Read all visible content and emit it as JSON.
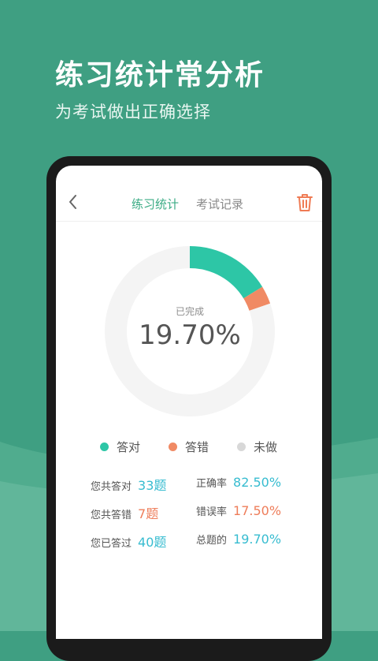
{
  "hero": {
    "title": "练习统计常分析",
    "subtitle": "为考试做出正确选择"
  },
  "app": {
    "tabs": [
      {
        "label": "练习统计",
        "active": true
      },
      {
        "label": "考试记录",
        "active": false
      }
    ],
    "icons": {
      "back": "chevron-left-icon",
      "delete": "trash-icon"
    }
  },
  "chart_data": {
    "type": "pie",
    "style": "donut",
    "center_label": "已完成",
    "center_value": "19.70%",
    "series": [
      {
        "name": "答对",
        "value": 33,
        "color": "#2dc6a6"
      },
      {
        "name": "答错",
        "value": 7,
        "color": "#f08a64"
      },
      {
        "name": "未做",
        "value": 163,
        "color": "#f4f4f4"
      }
    ]
  },
  "legend": [
    {
      "label": "答对",
      "color": "#2dc6a6"
    },
    {
      "label": "答错",
      "color": "#f08a64"
    },
    {
      "label": "未做",
      "color": "#d8d8d8"
    }
  ],
  "stats": {
    "total_correct": {
      "label": "您共答对",
      "value": "33题"
    },
    "total_wrong": {
      "label": "您共答错",
      "value": "7题"
    },
    "total_done": {
      "label": "您已答过",
      "value": "40题"
    },
    "accuracy": {
      "label": "正确率",
      "value": "82.50%"
    },
    "error_rate": {
      "label": "错误率",
      "value": "17.50%"
    },
    "completion": {
      "label": "总题的",
      "value": "19.70%"
    }
  },
  "colors": {
    "brand": "#3f9f82",
    "active_tab": "#3aab84",
    "correct": "#2dc6a6",
    "wrong": "#f08a64",
    "stat_teal": "#37bcd0",
    "stat_orange": "#ee7d5a"
  }
}
